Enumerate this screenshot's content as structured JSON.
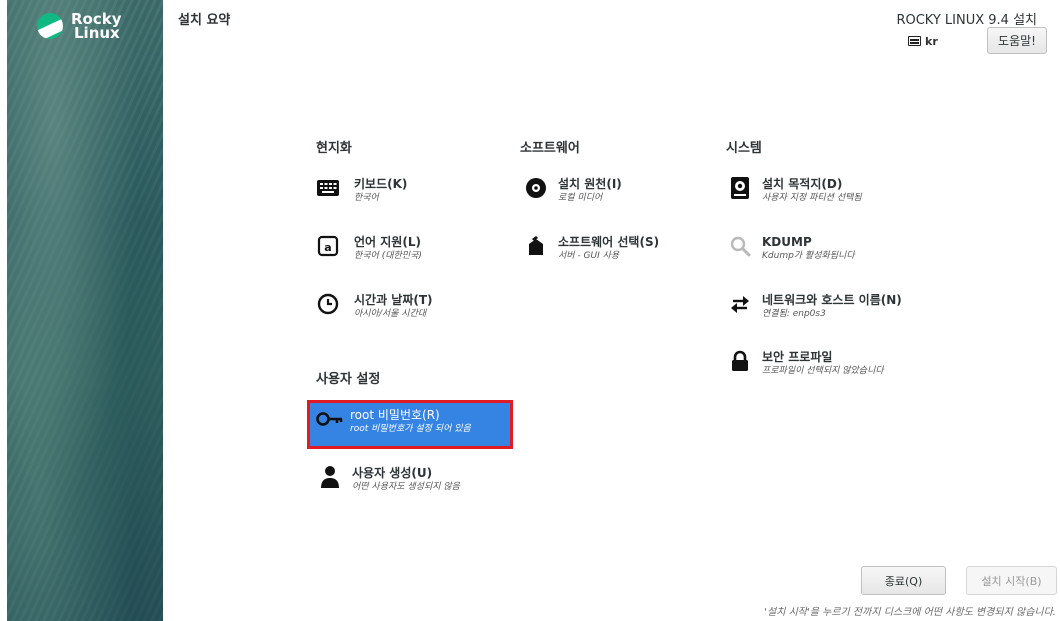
{
  "brand": {
    "line1": "Rocky",
    "line2": "Linux"
  },
  "header": {
    "title": "설치 요약",
    "install_title": "ROCKY LINUX 9.4 설치",
    "keyboard_layout": "kr",
    "help_label": "도움말!"
  },
  "sections": {
    "localization": {
      "title": "현지화",
      "keyboard": {
        "label": "키보드(K)",
        "status": "한국어"
      },
      "language": {
        "label": "언어 지원(L)",
        "status": "한국어 (대한민국)"
      },
      "datetime": {
        "label": "시간과 날짜(T)",
        "status": "아시아/서울 시간대"
      }
    },
    "software": {
      "title": "소프트웨어",
      "source": {
        "label": "설치 원천(I)",
        "status": "로컬 미디어"
      },
      "selection": {
        "label": "소프트웨어 선택(S)",
        "status": "서버 - GUI 사용"
      }
    },
    "system": {
      "title": "시스템",
      "destination": {
        "label": "설치 목적지(D)",
        "status": "사용자 지정 파티션 선택됨"
      },
      "kdump": {
        "label": "KDUMP",
        "status": "Kdump가 활성화됩니다"
      },
      "network": {
        "label": "네트워크와 호스트 이름(N)",
        "status": "연결됨: enp0s3"
      },
      "security": {
        "label": "보안 프로파일",
        "status": "프로파일이 선택되지 않았습니다"
      }
    },
    "user": {
      "title": "사용자 설정",
      "root": {
        "label": "root 비밀번호(R)",
        "status": "root 비밀번호가 설정 되어 있음"
      },
      "create_user": {
        "label": "사용자 생성(U)",
        "status": "어떤 사용자도 생성되지 않음"
      }
    }
  },
  "footer": {
    "quit_label": "종료(Q)",
    "begin_label": "설치 시작(B)",
    "note": "'설치 시작'을 누르기 전까지 디스크에 어떤 사항도 변경되지 않습니다."
  },
  "colors": {
    "accent": "#3584e4",
    "highlight_border": "#e01b24",
    "brand_green": "#10b981"
  }
}
